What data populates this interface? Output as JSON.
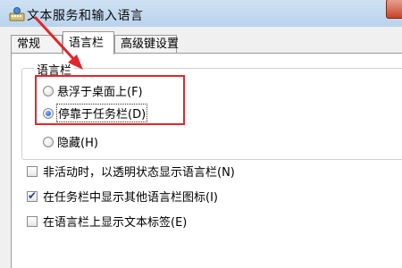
{
  "window": {
    "title": "文本服务和输入语言",
    "icon": "keyboard-app-icon"
  },
  "tabs": [
    {
      "label": "常规",
      "selected": false
    },
    {
      "label": "语言栏",
      "selected": true
    },
    {
      "label": "高级键设置",
      "selected": false
    }
  ],
  "language_bar": {
    "group_label": "语言栏",
    "options": [
      {
        "label": "悬浮于桌面上(F)",
        "checked": false
      },
      {
        "label": "停靠于任务栏(D)",
        "checked": true
      },
      {
        "label": "隐藏(H)",
        "checked": false
      }
    ]
  },
  "checkboxes": [
    {
      "label": "非活动时，以透明状态显示语言栏(N)",
      "checked": false
    },
    {
      "label": "在任务栏中显示其他语言栏图标(I)",
      "checked": true
    },
    {
      "label": "在语言栏上显示文本标签(E)",
      "checked": false
    }
  ],
  "annotation": {
    "highlight_color": "#e3262b",
    "arrow_color": "#e3262b"
  }
}
